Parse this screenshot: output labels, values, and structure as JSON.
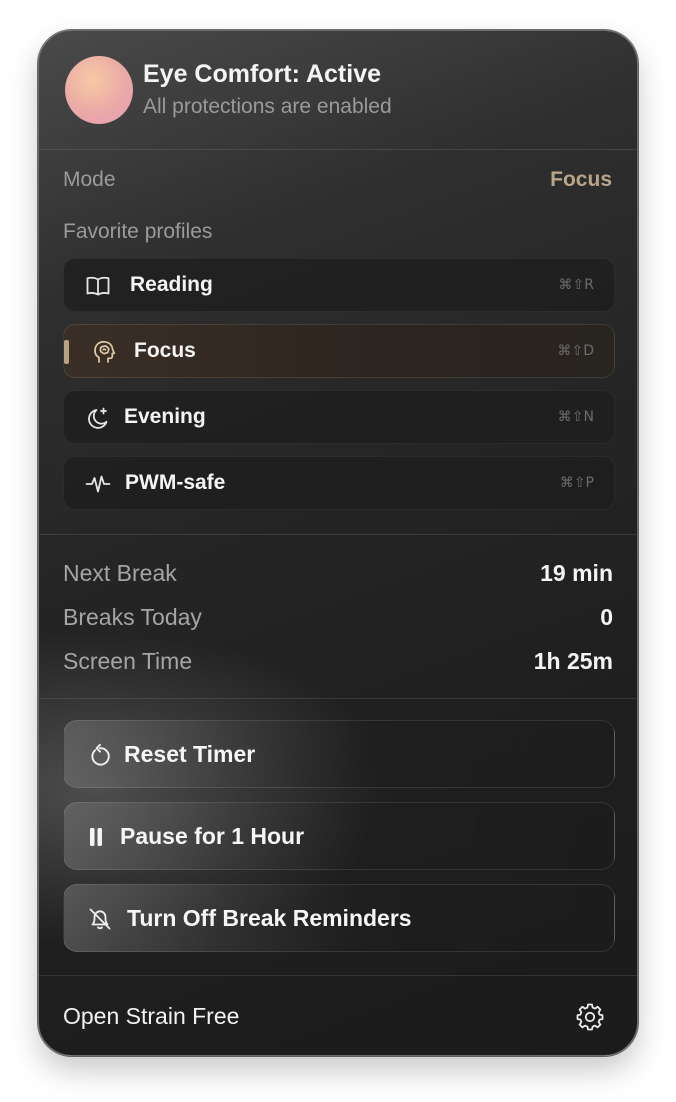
{
  "header": {
    "title": "Eye Comfort: Active",
    "subtitle": "All protections are enabled"
  },
  "mode": {
    "label": "Mode",
    "value": "Focus"
  },
  "favorites": {
    "label": "Favorite profiles",
    "items": [
      {
        "name": "Reading",
        "shortcut": "⌘⇧R",
        "icon": "book-icon",
        "active": false
      },
      {
        "name": "Focus",
        "shortcut": "⌘⇧D",
        "icon": "brain-icon",
        "active": true
      },
      {
        "name": "Evening",
        "shortcut": "⌘⇧N",
        "icon": "moon-icon",
        "active": false
      },
      {
        "name": "PWM-safe",
        "shortcut": "⌘⇧P",
        "icon": "waveform-icon",
        "active": false
      }
    ]
  },
  "stats": [
    {
      "label": "Next Break",
      "value": "19 min"
    },
    {
      "label": "Breaks Today",
      "value": "0"
    },
    {
      "label": "Screen Time",
      "value": "1h 25m"
    }
  ],
  "actions": [
    {
      "label": "Reset Timer",
      "icon": "reset-icon"
    },
    {
      "label": "Pause for 1 Hour",
      "icon": "pause-icon"
    },
    {
      "label": "Turn Off Break Reminders",
      "icon": "bell-slash-icon"
    }
  ],
  "footer": {
    "open_label": "Open Strain Free",
    "settings_icon": "gear-icon"
  },
  "colors": {
    "accent": "#b9a587",
    "panel_background": "#232323",
    "secondary_text": "#9b9b9b"
  }
}
